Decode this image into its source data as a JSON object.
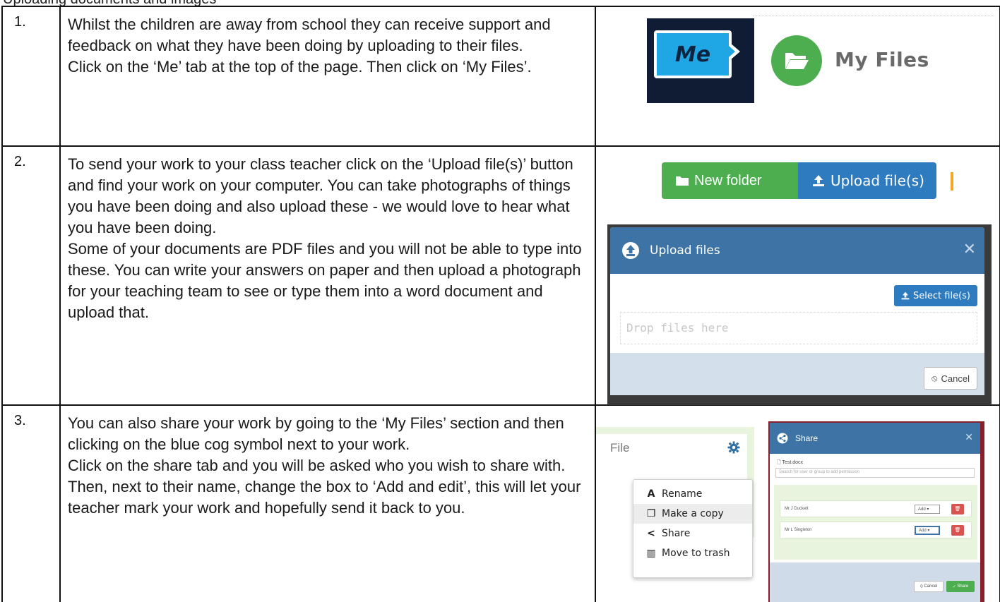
{
  "doc": {
    "cut_heading": "Uploading documents and images",
    "steps": [
      {
        "num": "1.",
        "lines": [
          "Whilst the children are away from school they can receive support and feedback on what they have been doing by uploading to their files.",
          "Click on the ‘Me’ tab at the top of the page. Then click on ‘My Files’."
        ]
      },
      {
        "num": "2.",
        "lines": [
          "To send your work to your class teacher click on the ‘Upload file(s)’ button and find your work on your computer. You can take photographs of things you have been doing and also upload these - we would love to hear what you have been doing.",
          "Some of your documents are PDF files and you will not be able to type into these. You can write your answers on paper and then upload a photograph for your teaching team to see or type them into a word document and upload that."
        ]
      },
      {
        "num": "3.",
        "lines": [
          "You can also share your work by going to the ‘My Files’ section and then clicking on the blue cog symbol next to your work.",
          "Click on the share tab and you will be asked who you wish to share with.  Then, next to their name, change the box to ‘Add and edit’, this will let your teacher mark your work and hopefully send it back to you."
        ]
      }
    ]
  },
  "shot1": {
    "me_label": "Me",
    "myfiles_label": "My Files",
    "folder_icon": "folder-open-icon"
  },
  "shot2": {
    "new_folder_label": "New folder",
    "upload_label": "Upload file(s)",
    "dialog_title": "Upload files",
    "select_label": "Select file(s)",
    "drop_placeholder": "Drop files here",
    "cancel_label": "Cancel"
  },
  "shot3": {
    "file_label": "File",
    "menu": [
      "Rename",
      "Make a copy",
      "Share",
      "Move to trash"
    ],
    "share_title": "Share",
    "share_filename": "Test.docx",
    "share_search_placeholder": "Search for user or group to add permission",
    "people": [
      {
        "name": "Mr J Duckett",
        "perm": "Add"
      },
      {
        "name": "Mr L Singleton",
        "perm": "Add"
      }
    ],
    "share_cancel": "Cancel",
    "share_button": "Share",
    "colors": {
      "blue": "#3d74a5",
      "green": "#4cae4f",
      "red": "#d9534f"
    }
  }
}
